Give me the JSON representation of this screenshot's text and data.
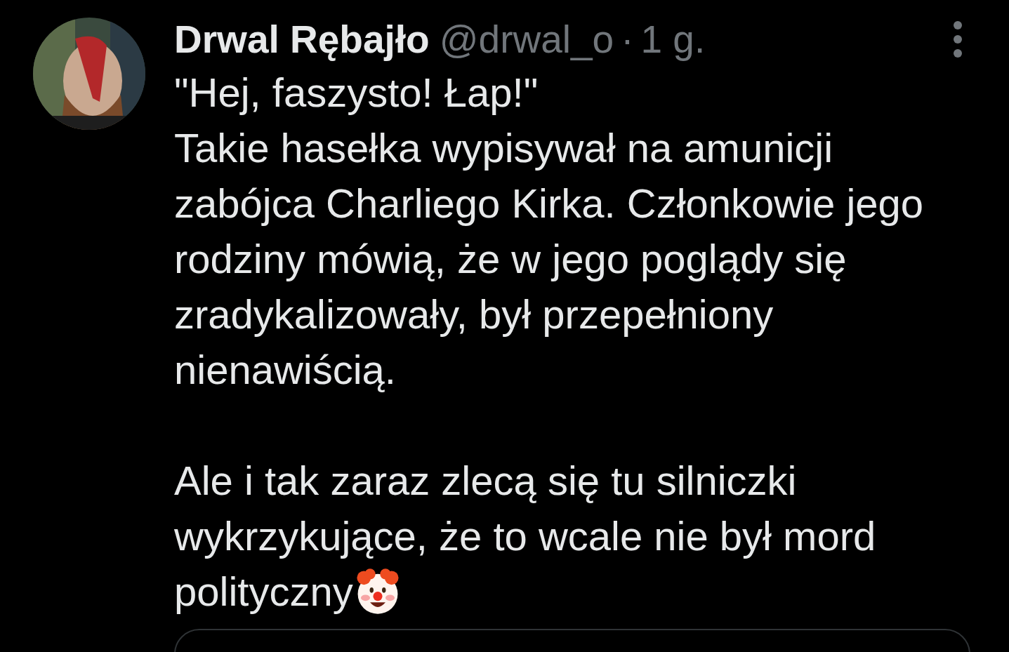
{
  "tweet": {
    "author": {
      "display_name": "Drwal Rębajło",
      "handle": "@drwal_o",
      "separator": "·",
      "time": "1 g."
    },
    "paragraphs": [
      [
        "\"Hej, faszysto! Łap!\"",
        "Takie hasełka wypisywał na amunicji",
        "zabójca Charliego Kirka. Członkowie jego",
        "rodziny mówią, że w jego poglądy się",
        "zradykalizowały, był przepełniony",
        "nienawiścią."
      ],
      [
        "Ale i tak zaraz zlecą się tu silniczki",
        "wykrzykujące, że to wcale nie był mord",
        "polityczny"
      ]
    ],
    "trailing_emoji": {
      "kind": "clown"
    },
    "quoted_card": {
      "kind": "card"
    }
  }
}
